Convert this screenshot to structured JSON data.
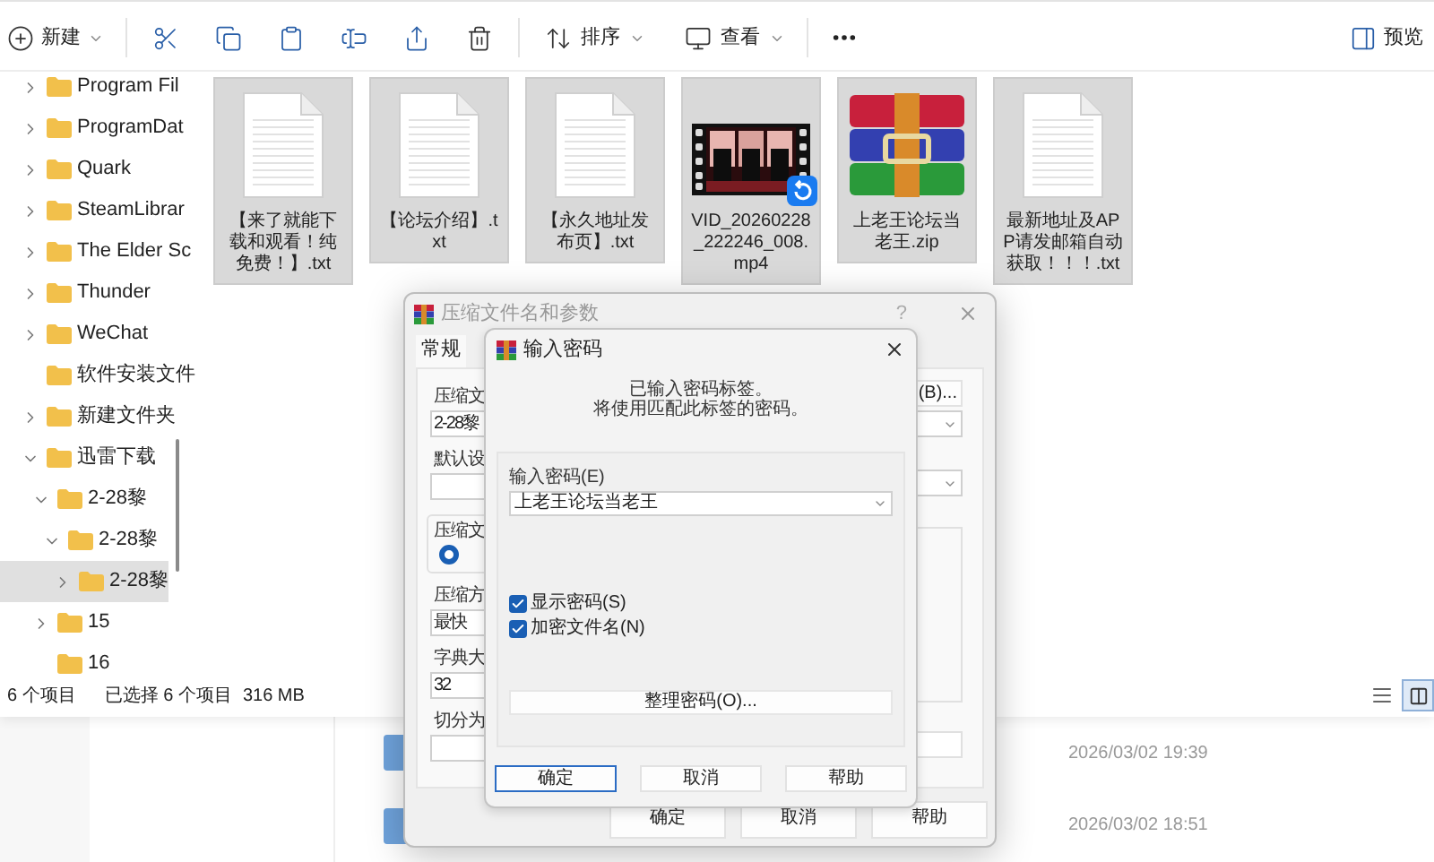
{
  "toolbar": {
    "new_label": "新建",
    "sort_label": "排序",
    "view_label": "查看",
    "preview_label": "预览"
  },
  "sidebar": {
    "items": [
      {
        "kind": "branch",
        "label": "Program Fil",
        "expanded": false,
        "selected": false
      },
      {
        "kind": "branch",
        "label": "ProgramDat",
        "expanded": false,
        "selected": false
      },
      {
        "kind": "branch",
        "label": "Quark",
        "expanded": false,
        "selected": false
      },
      {
        "kind": "branch",
        "label": "SteamLibrar",
        "expanded": false,
        "selected": false
      },
      {
        "kind": "branch",
        "label": "The Elder Sc",
        "expanded": false,
        "selected": false
      },
      {
        "kind": "branch",
        "label": "Thunder",
        "expanded": false,
        "selected": false
      },
      {
        "kind": "branch",
        "label": "WeChat",
        "expanded": false,
        "selected": false
      },
      {
        "kind": "leaf",
        "label": "软件安装文件",
        "selected": false
      },
      {
        "kind": "branch",
        "label": "新建文件夹",
        "expanded": false,
        "selected": false
      },
      {
        "kind": "branch",
        "label": "迅雷下载",
        "expanded": true,
        "selected": false,
        "children": [
          {
            "kind": "branch",
            "label": "2-28黎",
            "expanded": true,
            "selected": false,
            "children": [
              {
                "kind": "branch",
                "label": "2-28黎",
                "expanded": true,
                "selected": false,
                "children": [
                  {
                    "kind": "branch",
                    "label": "2-28黎",
                    "expanded": false,
                    "selected": true
                  }
                ]
              }
            ]
          },
          {
            "kind": "branch",
            "label": "15",
            "expanded": false,
            "selected": false
          },
          {
            "kind": "leaf",
            "label": "16",
            "selected": false
          }
        ]
      }
    ]
  },
  "files": [
    {
      "kind": "text",
      "name": "【来了就能下载和观看！纯免费！】.txt",
      "selected": true
    },
    {
      "kind": "text",
      "name": "【论坛介绍】.txt",
      "selected": true
    },
    {
      "kind": "text",
      "name": "【永久地址发布页】.txt",
      "selected": true
    },
    {
      "kind": "video",
      "name": "VID_20260228_222246_008.mp4",
      "selected": true
    },
    {
      "kind": "archive",
      "name": "上老王论坛当老王.zip",
      "selected": true
    },
    {
      "kind": "text",
      "name": "最新地址及APP请发邮箱自动获取！！！.txt",
      "selected": true
    }
  ],
  "status_bar": {
    "count": "6 个项目",
    "selection": "已选择 6 个项目",
    "size": "316 MB"
  },
  "background_window": {
    "rows": [
      {
        "date": "2026/03/02 19:39"
      },
      {
        "date": "2026/03/02 18:51"
      }
    ]
  },
  "archive_dialog": {
    "title": "压缩文件名和参数",
    "help": "?",
    "tabs": [
      {
        "label": "常规",
        "selected": true
      }
    ],
    "left": [
      {
        "kind": "label",
        "text": "压缩文"
      },
      {
        "kind": "field",
        "value": "2-28黎"
      },
      {
        "kind": "label",
        "text": "默认设"
      },
      {
        "kind": "field"
      },
      {
        "kind": "group",
        "text": "压缩文",
        "radio_selected": true
      },
      {
        "kind": "label",
        "text": "压缩方"
      },
      {
        "kind": "field",
        "value": "最快"
      },
      {
        "kind": "label",
        "text": "字典大"
      },
      {
        "kind": "field",
        "value": "32"
      },
      {
        "kind": "label",
        "text": "切分为"
      },
      {
        "kind": "field"
      }
    ],
    "right": [
      {
        "kind": "button",
        "text": "(B)..."
      },
      {
        "kind": "dropdown"
      },
      {
        "kind": "dropdown"
      },
      {
        "kind": "box"
      },
      {
        "kind": "field"
      }
    ],
    "buttons": [
      "确定",
      "取消",
      "帮助"
    ]
  },
  "password_dialog": {
    "title": "输入密码",
    "message": [
      "已输入密码标签。",
      "将使用匹配此标签的密码。"
    ],
    "password_label": "输入密码(E)",
    "password_value": "上老王论坛当老王",
    "options": [
      {
        "label": "显示密码(S)",
        "checked": true
      },
      {
        "label": "加密文件名(N)",
        "checked": true
      }
    ],
    "organize_button": "整理密码(O)...",
    "buttons": [
      {
        "label": "确定",
        "focused": true
      },
      {
        "label": "取消",
        "focused": false
      },
      {
        "label": "帮助",
        "focused": false
      }
    ]
  }
}
